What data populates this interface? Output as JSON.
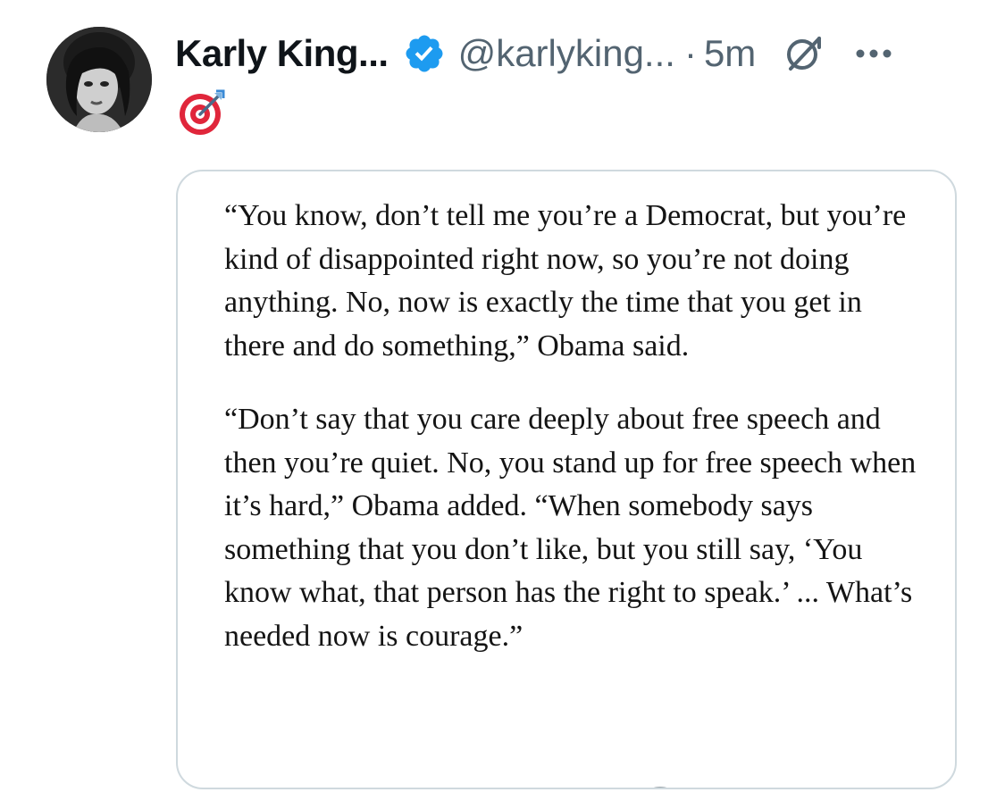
{
  "post": {
    "author_name": "Karly King...",
    "handle": "@karlyking...",
    "separator": "·",
    "time": "5m",
    "status_emoji": "🎯"
  },
  "icons": {
    "avatar": "profile-photo",
    "verified": "verified-badge-icon",
    "grok": "grok-icon",
    "more": "more-options-icon",
    "status": "direct-hit-target-emoji"
  },
  "colors": {
    "verified_blue": "#1d9bf0",
    "secondary_text": "#536471",
    "border": "#cfd9de",
    "primary_text": "#0f1419"
  },
  "quote": {
    "paragraph_1": "“You know, don’t tell me you’re a Democrat, but you’re kind of disappointed right now, so you’re not doing anything. No, now is exactly the time that you get in there and do something,” Obama said.",
    "paragraph_2": "“Don’t say that you care deeply about free speech and then you’re quiet. No, you stand up for free speech when it’s hard,” Obama added. “When somebody says something that you don’t like, but you still say, ‘You know what, that person has the right to speak.’ ... What’s needed now is courage.”"
  }
}
